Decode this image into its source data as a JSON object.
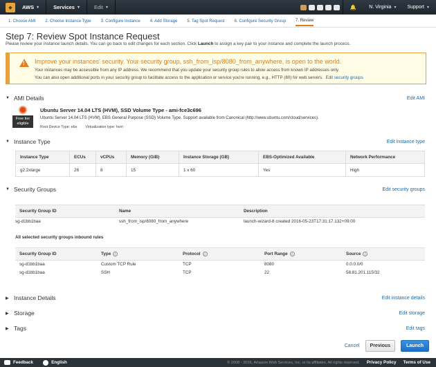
{
  "topnav": {
    "brand": "AWS",
    "services": "Services",
    "edit": "Edit",
    "region": "N. Virginia",
    "support": "Support"
  },
  "tabs": [
    "1. Choose AMI",
    "2. Choose Instance Type",
    "3. Configure Instance",
    "4. Add Storage",
    "5. Tag Spot Request",
    "6. Configure Security Group",
    "7. Review"
  ],
  "page": {
    "title": "Step 7: Review Spot Instance Request",
    "sub_before": "Please review your instance launch details. You can go back to edit changes for each section. Click ",
    "sub_bold": "Launch",
    "sub_after": " to assign a key pair to your instance and complete the launch process."
  },
  "warning": {
    "title": "Improve your instances' security. Your security group, ssh_from_isp/8080_from_anywhere, is open to the world.",
    "line1": "Your instances may be accessible from any IP address. We recommend that you update your security group rules to allow access from known IP addresses only.",
    "line2": "You can also open additional ports in your security group to facilitate access to the application or service you're running, e.g., HTTP (80) for web servers.",
    "link": "Edit security groups"
  },
  "ami": {
    "header": "AMI Details",
    "edit": "Edit AMI",
    "free_tier": "Free tier eligible",
    "name": "Ubuntu Server 14.04 LTS (HVM), SSD Volume Type - ami-fce3c696",
    "desc": "Ubuntu Server 14.04 LTS (HVM), EBS General Purpose (SSD) Volume Type. Support available from Canonical (http://www.ubuntu.com/cloud/services).",
    "root_device": "Root Device Type: ebs",
    "virtualization": "Virtualization type: hvm"
  },
  "instance_type": {
    "header": "Instance Type",
    "edit": "Edit instance type",
    "columns": [
      "Instance Type",
      "ECUs",
      "vCPUs",
      "Memory (GiB)",
      "Instance Storage (GB)",
      "EBS-Optimized Available",
      "Network Performance"
    ],
    "row": [
      "g2.2xlarge",
      "26",
      "8",
      "15",
      "1 x 60",
      "Yes",
      "High"
    ]
  },
  "security_groups": {
    "header": "Security Groups",
    "edit": "Edit security groups",
    "columns": [
      "Security Group ID",
      "Name",
      "Description"
    ],
    "row": [
      "sg-d1bb1baa",
      "ssh_from_isp/8080_from_anywhere",
      "launch-wizard-8 created 2016-05-23T17:31:17.132+09:00"
    ],
    "inbound_label": "All selected security groups inbound rules",
    "rule_columns": [
      "Security Group ID",
      "Type",
      "Protocol",
      "Port Range",
      "Source"
    ],
    "rules": [
      [
        "sg-d1bb1baa",
        "Custom TCP Rule",
        "TCP",
        "8080",
        "0.0.0.0/0"
      ],
      [
        "sg-d1bb1baa",
        "SSH",
        "TCP",
        "22",
        "58.81.201.115/32"
      ]
    ]
  },
  "collapsed": [
    {
      "header": "Instance Details",
      "edit": "Edit instance details"
    },
    {
      "header": "Storage",
      "edit": "Edit storage"
    },
    {
      "header": "Tags",
      "edit": "Edit tags"
    }
  ],
  "buttons": {
    "cancel": "Cancel",
    "previous": "Previous",
    "launch": "Launch"
  },
  "footer": {
    "feedback": "Feedback",
    "language": "English",
    "copyright": "© 2008 - 2016, Amazon Web Services, Inc. or its affiliates. All rights reserved.",
    "privacy": "Privacy Policy",
    "terms": "Terms of Use"
  }
}
